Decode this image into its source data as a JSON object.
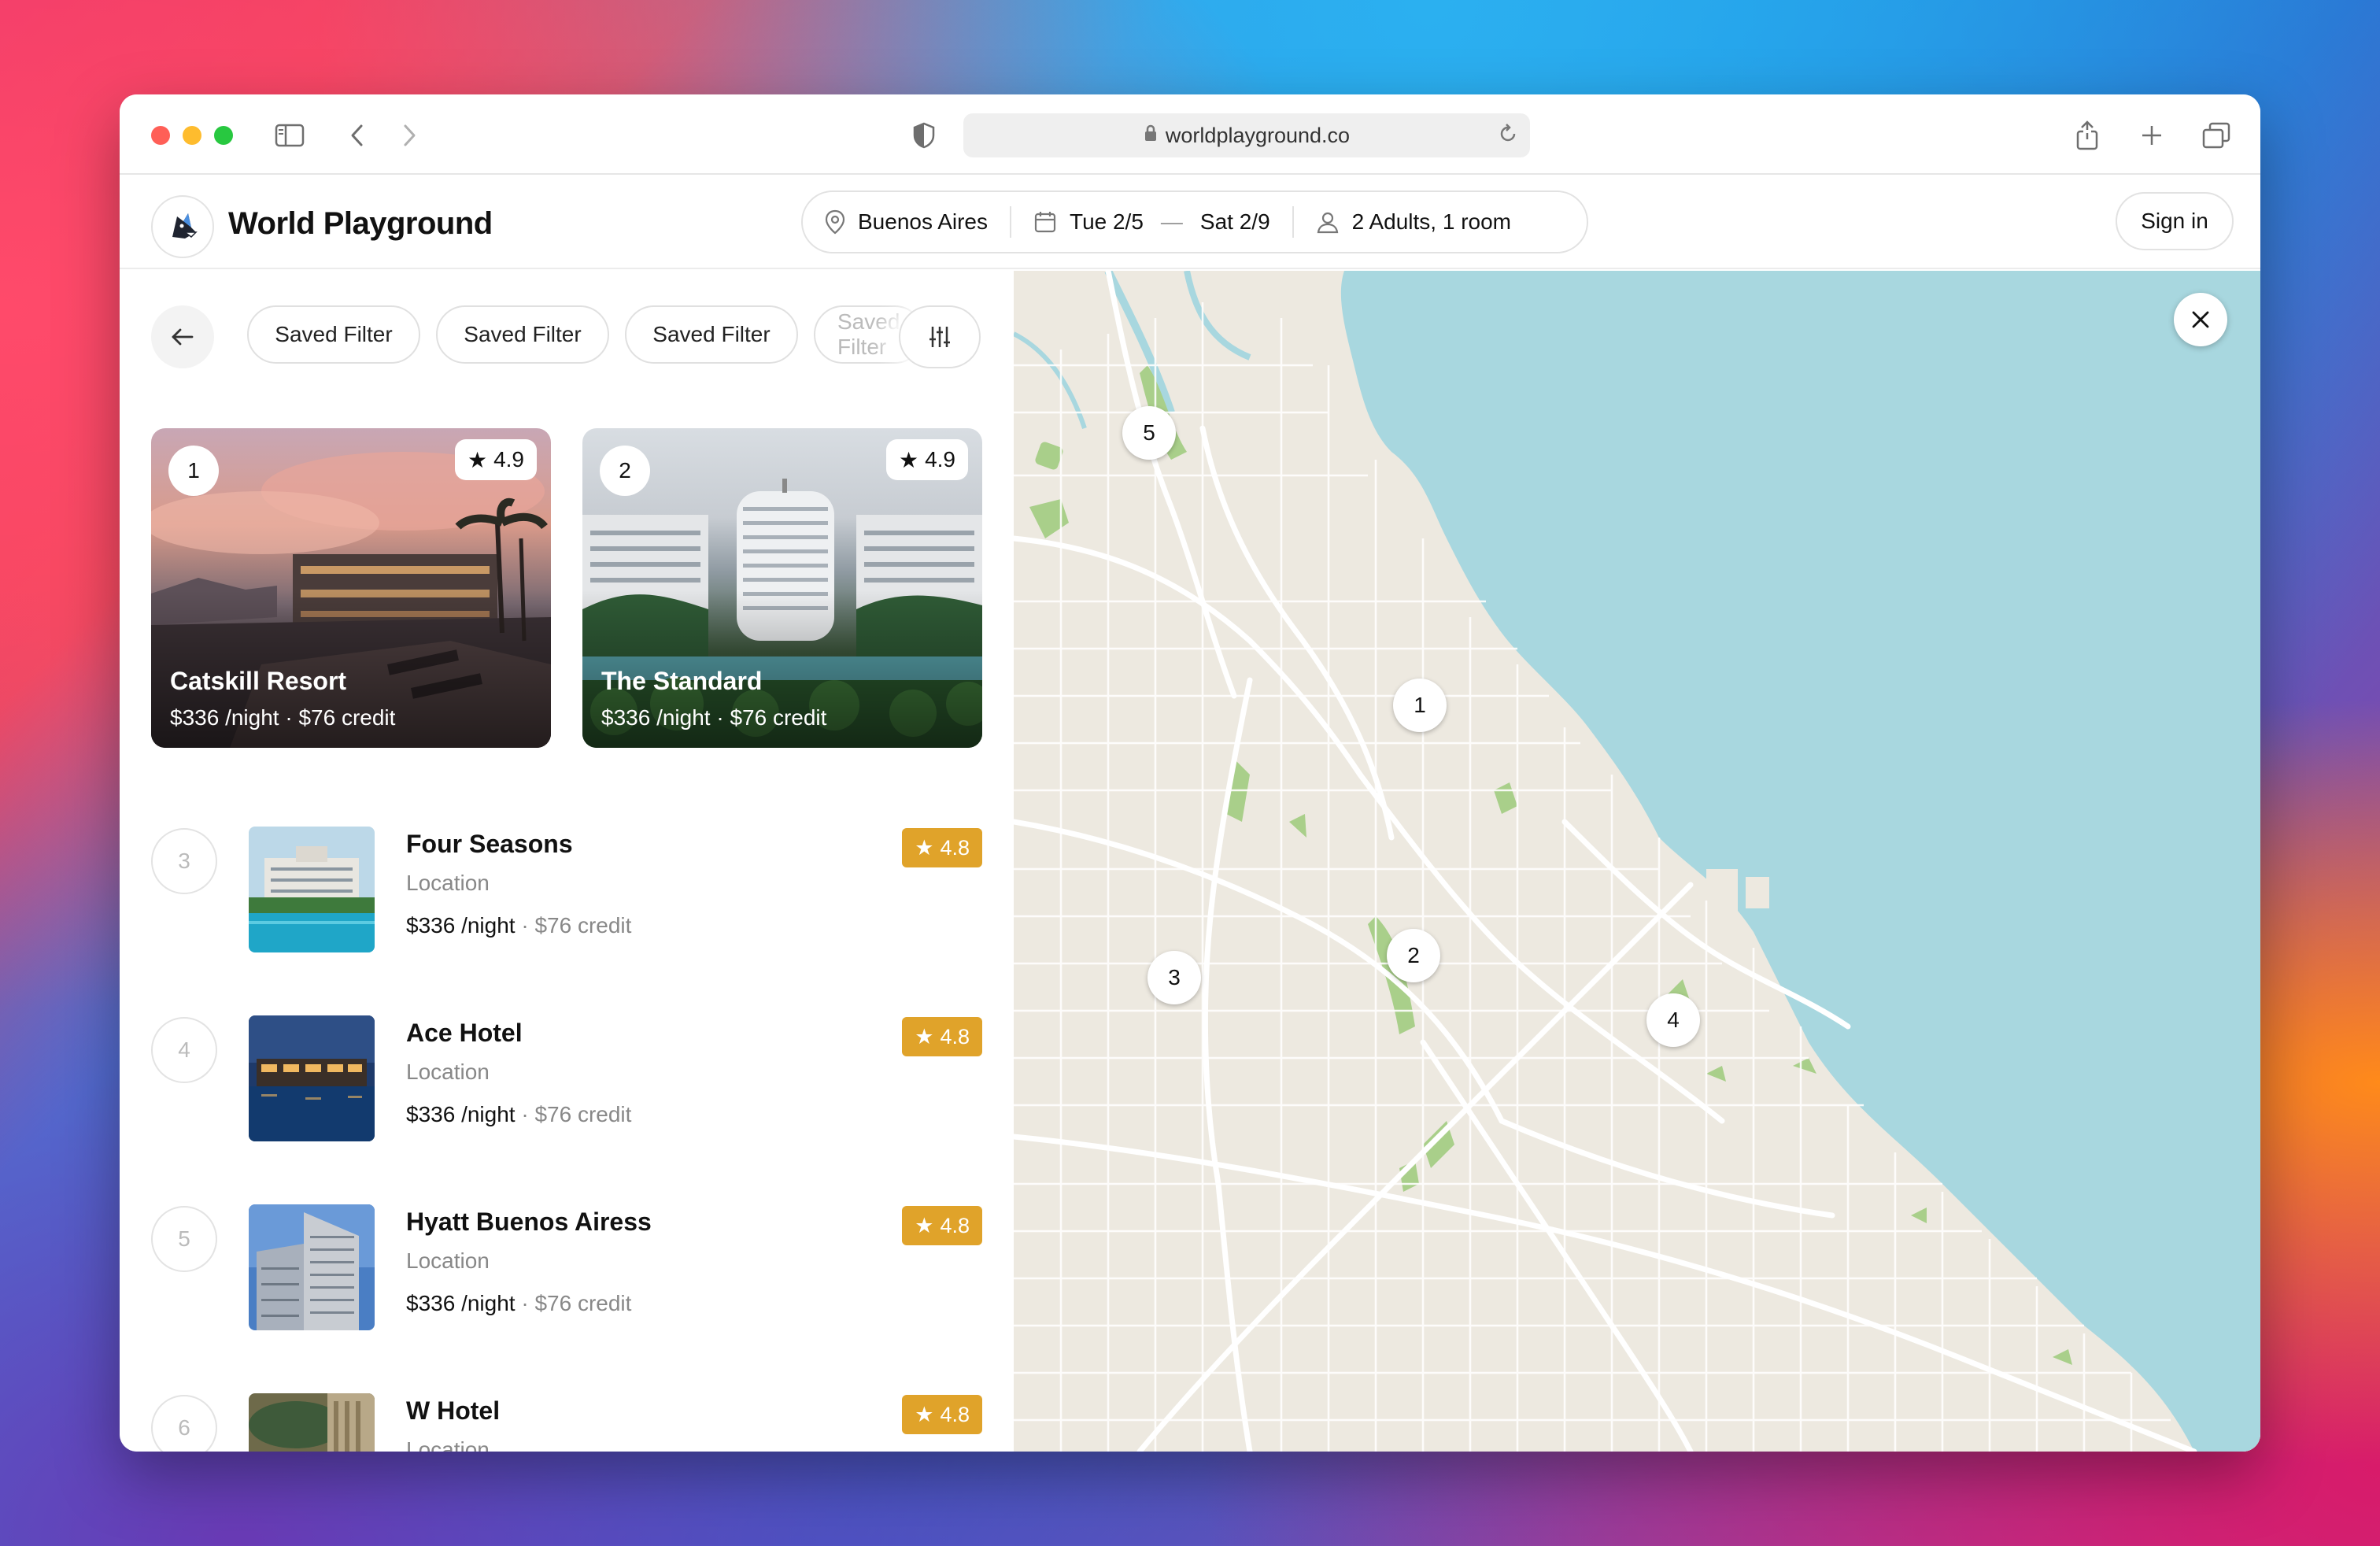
{
  "browser": {
    "url": "worldplayground.co",
    "icons": [
      "sidebar-icon",
      "back-icon",
      "forward-icon",
      "shield-icon",
      "lock-icon",
      "reload-icon",
      "share-icon",
      "new-tab-icon",
      "tabs-icon"
    ]
  },
  "header": {
    "brand": "World Playground",
    "location": "Buenos Aires",
    "check_in": "Tue 2/5",
    "dash": "—",
    "check_out": "Sat 2/9",
    "guests": "2 Adults, 1 room",
    "signin": "Sign in"
  },
  "filters": {
    "chips": [
      "Saved Filter",
      "Saved Filter",
      "Saved Filter",
      "Saved Filter"
    ]
  },
  "featured": [
    {
      "num": "1",
      "rating": "4.9",
      "title": "Catskill Resort",
      "price": "$336 /night · $76 credit"
    },
    {
      "num": "2",
      "rating": "4.9",
      "title": "The Standard",
      "price": "$336 /night · $76 credit"
    }
  ],
  "hotels": [
    {
      "num": "3",
      "name": "Four Seasons",
      "location": "Location",
      "price": "$336 /night",
      "credit": " · $76 credit",
      "rating": "4.8"
    },
    {
      "num": "4",
      "name": "Ace Hotel",
      "location": "Location",
      "price": "$336 /night",
      "credit": " · $76 credit",
      "rating": "4.8"
    },
    {
      "num": "5",
      "name": "Hyatt Buenos Airess",
      "location": "Location",
      "price": "$336 /night",
      "credit": " · $76 credit",
      "rating": "4.8"
    },
    {
      "num": "6",
      "name": "W Hotel",
      "location": "Location",
      "price": "",
      "credit": "",
      "rating": "4.8"
    }
  ],
  "map": {
    "markers": [
      "1",
      "2",
      "3",
      "4",
      "5"
    ],
    "water_color": "#a8d7df",
    "land_color": "#ede9e0",
    "park_color": "#a9cf8a"
  },
  "colors": {
    "rating_badge": "#e0a32a",
    "traffic_red": "#ff5f57",
    "traffic_yellow": "#febc2e",
    "traffic_green": "#28c840"
  }
}
